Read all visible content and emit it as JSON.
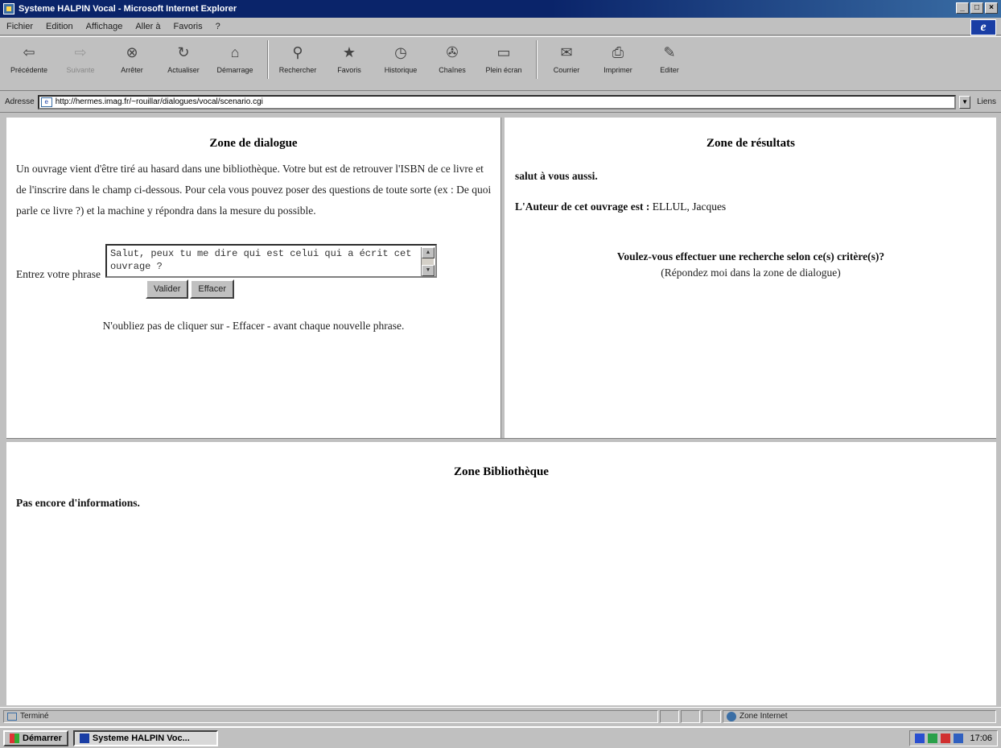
{
  "window": {
    "title": "Systeme HALPIN Vocal - Microsoft Internet Explorer",
    "controls": [
      "_",
      "□",
      "×"
    ]
  },
  "menu": {
    "items": [
      "Fichier",
      "Edition",
      "Affichage",
      "Aller à",
      "Favoris",
      "?"
    ]
  },
  "toolbar": {
    "items": [
      {
        "label": "Précédente",
        "icon": "back-arrow-icon",
        "glyph": "⇦",
        "enabled": true
      },
      {
        "label": "Suivante",
        "icon": "forward-arrow-icon",
        "glyph": "⇨",
        "enabled": false
      },
      {
        "label": "Arrêter",
        "icon": "stop-icon",
        "glyph": "⊗",
        "enabled": true
      },
      {
        "label": "Actualiser",
        "icon": "refresh-icon",
        "glyph": "↻",
        "enabled": true
      },
      {
        "label": "Démarrage",
        "icon": "home-icon",
        "glyph": "⌂",
        "enabled": true
      },
      {
        "label": "Rechercher",
        "icon": "search-icon",
        "glyph": "⚲",
        "enabled": true
      },
      {
        "label": "Favoris",
        "icon": "favorites-icon",
        "glyph": "★",
        "enabled": true
      },
      {
        "label": "Historique",
        "icon": "history-icon",
        "glyph": "◷",
        "enabled": true
      },
      {
        "label": "Chaînes",
        "icon": "channels-icon",
        "glyph": "✇",
        "enabled": true
      },
      {
        "label": "Plein écran",
        "icon": "fullscreen-icon",
        "glyph": "▭",
        "enabled": true
      },
      {
        "label": "Courrier",
        "icon": "mail-icon",
        "glyph": "✉",
        "enabled": true
      },
      {
        "label": "Imprimer",
        "icon": "print-icon",
        "glyph": "⎙",
        "enabled": true
      },
      {
        "label": "Editer",
        "icon": "edit-icon",
        "glyph": "✎",
        "enabled": true
      }
    ]
  },
  "address": {
    "label": "Adresse",
    "url": "http://hermes.imag.fr/~rouillar/dialogues/vocal/scenario.cgi",
    "go_label": "Liens"
  },
  "dialog": {
    "title": "Zone de dialogue",
    "intro": "Un ouvrage vient d'être tiré au hasard dans une bibliothèque. Votre but est de retrouver l'ISBN de ce livre et de l'inscrire dans le champ ci-dessous. Pour cela vous pouvez poser des questions de toute sorte (ex : De quoi parle ce livre ?) et la machine y répondra dans la mesure du possible.",
    "input_label": "Entrez votre phrase",
    "input_value": "Salut, peux tu me dire qui est celui qui a écrit cet ouvrage ?",
    "validate_label": "Valider",
    "clear_label": "Effacer",
    "note": "N'oubliez pas de cliquer sur - Effacer - avant chaque nouvelle phrase."
  },
  "results": {
    "title": "Zone de résultats",
    "greeting": "salut à vous aussi.",
    "author_prefix": "L'Auteur de cet ouvrage est :",
    "author_value": "ELLUL, Jacques",
    "question": "Voulez-vous effectuer une recherche selon ce(s) critère(s)?",
    "hint": "(Répondez moi dans la zone de dialogue)"
  },
  "library": {
    "title": "Zone Bibliothèque",
    "text": "Pas encore d'informations."
  },
  "status": {
    "text": "Terminé",
    "zone": "Zone Internet"
  },
  "taskbar": {
    "start_label": "Démarrer",
    "task_label": "Systeme HALPIN Voc...",
    "clock": "17:06"
  }
}
